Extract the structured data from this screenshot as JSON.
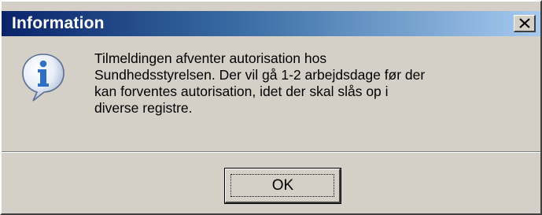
{
  "dialog": {
    "title": "Information",
    "close_glyph": "X",
    "icon": "information-icon",
    "message_lines": [
      "Tilmeldingen afventer autorisation hos",
      "Sundhedsstyrelsen. Der vil gå 1-2 arbejdsdage før der",
      "kan forventes autorisation, idet der skal slås op i",
      "diverse registre."
    ],
    "ok_label": "OK"
  },
  "colors": {
    "titlebar_start": "#0a246a",
    "titlebar_end": "#a6caf0",
    "face": "#d4d0c8",
    "icon_blue": "#2f6fc4"
  }
}
